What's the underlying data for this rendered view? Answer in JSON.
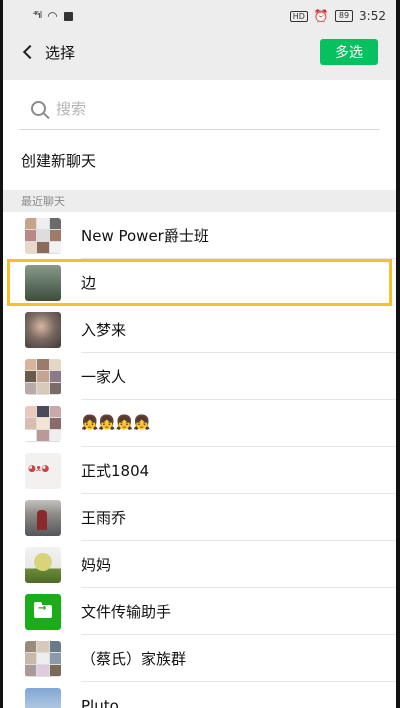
{
  "status_bar": {
    "signal": "⁴⁶ıl",
    "time": "3:52",
    "battery": "89",
    "hd": "HD",
    "alarm": "⏰"
  },
  "navbar": {
    "back_icon": "chevron-left-icon",
    "title": "选择",
    "multi_select_label": "多选"
  },
  "search": {
    "icon": "search-icon",
    "placeholder": "搜索"
  },
  "create_new_chat": "创建新聊天",
  "recent_section_label": "最近聊天",
  "highlight_color": "#f4c12b",
  "accent_color": "#07c160",
  "chats": [
    {
      "name": "New Power爵士班",
      "avatar": "group-grid"
    },
    {
      "name": "边",
      "avatar": "photo-landscape",
      "highlighted": true
    },
    {
      "name": "入梦来",
      "avatar": "photo-portrait"
    },
    {
      "name": "一家人",
      "avatar": "group-grid"
    },
    {
      "name": "👧👧👧👧",
      "avatar": "group-grid"
    },
    {
      "name": "正式1804",
      "avatar": "cat-icon"
    },
    {
      "name": "王雨乔",
      "avatar": "photo-person"
    },
    {
      "name": "妈妈",
      "avatar": "photo-flowers"
    },
    {
      "name": "文件传输助手",
      "avatar": "folder-icon"
    },
    {
      "name": "（蔡氏）家族群",
      "avatar": "group-grid"
    },
    {
      "name": "Pluto",
      "avatar": "photo-sky"
    }
  ]
}
